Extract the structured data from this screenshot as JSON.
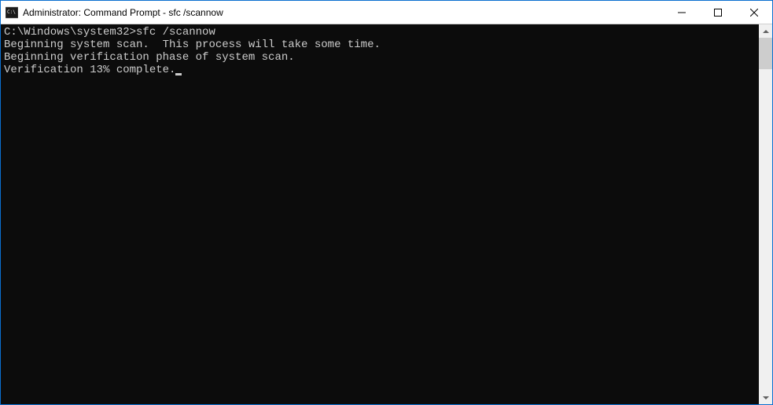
{
  "titlebar": {
    "title": "Administrator: Command Prompt - sfc  /scannow"
  },
  "terminal": {
    "prompt": "C:\\Windows\\system32>",
    "command": "sfc /scannow",
    "line_blank1": "",
    "line2": "Beginning system scan.  This process will take some time.",
    "line_blank2": "",
    "line3": "Beginning verification phase of system scan.",
    "line4": "Verification 13% complete."
  }
}
